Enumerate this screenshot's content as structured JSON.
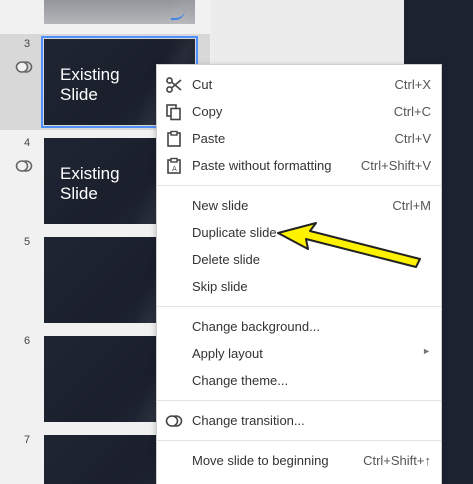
{
  "filmstrip": {
    "slides": [
      {
        "number": "3",
        "title_line1": "Existing",
        "title_line2": "Slide"
      },
      {
        "number": "4",
        "title_line1": "Existing",
        "title_line2": "Slide"
      },
      {
        "number": "5"
      },
      {
        "number": "6"
      },
      {
        "number": "7"
      }
    ]
  },
  "context_menu": {
    "cut": {
      "label": "Cut",
      "shortcut": "Ctrl+X",
      "icon": "scissors-icon"
    },
    "copy": {
      "label": "Copy",
      "shortcut": "Ctrl+C",
      "icon": "copy-icon"
    },
    "paste": {
      "label": "Paste",
      "shortcut": "Ctrl+V",
      "icon": "clipboard-icon"
    },
    "paste_plain": {
      "label": "Paste without formatting",
      "shortcut": "Ctrl+Shift+V",
      "icon": "paste-plain-icon"
    },
    "new_slide": {
      "label": "New slide",
      "shortcut": "Ctrl+M"
    },
    "duplicate_slide": {
      "label": "Duplicate slide"
    },
    "delete_slide": {
      "label": "Delete slide"
    },
    "skip_slide": {
      "label": "Skip slide"
    },
    "change_background": {
      "label": "Change background..."
    },
    "apply_layout": {
      "label": "Apply layout"
    },
    "change_theme": {
      "label": "Change theme..."
    },
    "change_transition": {
      "label": "Change transition...",
      "icon": "transition-icon"
    },
    "move_to_beginning": {
      "label": "Move slide to beginning",
      "shortcut": "Ctrl+Shift+↑"
    }
  },
  "colors": {
    "annotation_arrow": "#fff200",
    "selection_outline": "#4d90fe",
    "slide_background": "#1f2533"
  }
}
